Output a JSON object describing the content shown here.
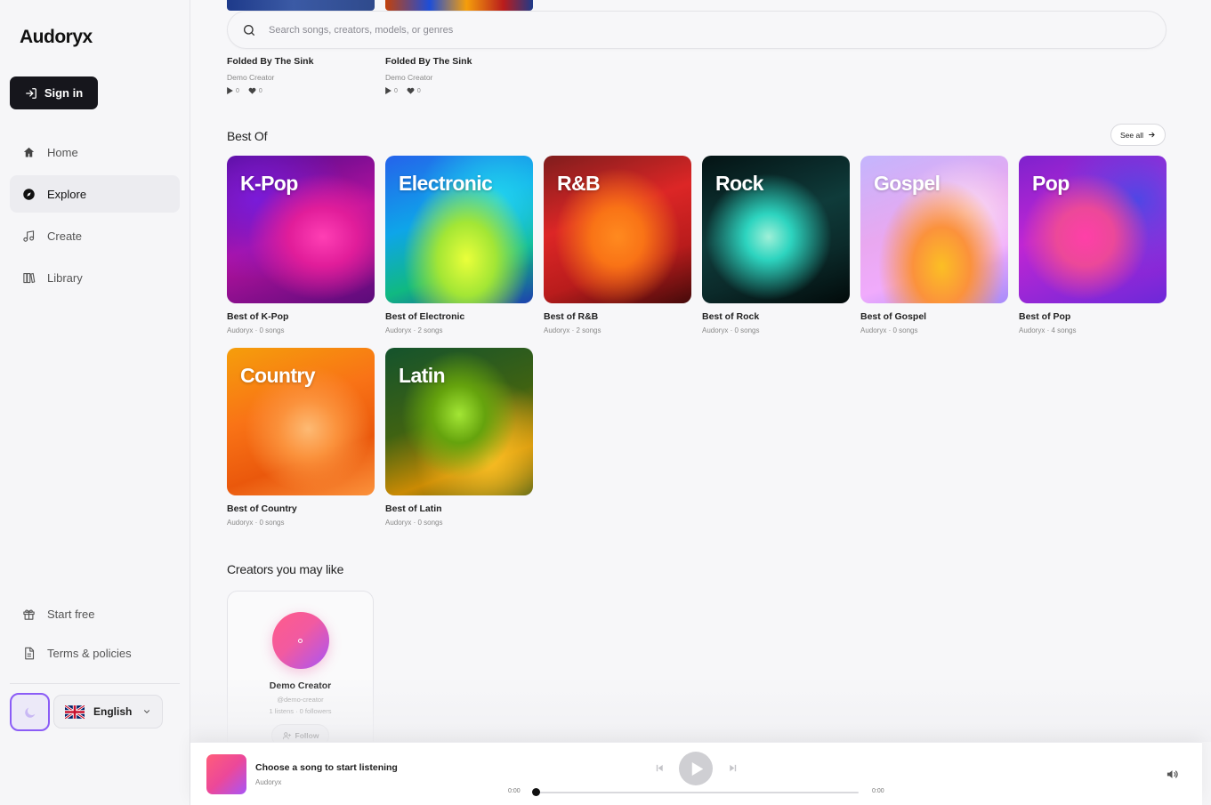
{
  "app": {
    "name": "Audoryx"
  },
  "sidebar": {
    "signin_label": "Sign in",
    "nav": [
      {
        "label": "Home",
        "icon": "home-icon"
      },
      {
        "label": "Explore",
        "icon": "compass-icon",
        "active": true
      },
      {
        "label": "Create",
        "icon": "music-note-icon"
      },
      {
        "label": "Library",
        "icon": "library-icon"
      }
    ],
    "bottom": [
      {
        "label": "Start free",
        "icon": "gift-icon"
      },
      {
        "label": "Terms & policies",
        "icon": "document-icon"
      }
    ],
    "language": "English"
  },
  "search": {
    "placeholder": "Search songs, creators, models, or genres"
  },
  "top_songs": [
    {
      "title": "Folded By The Sink",
      "creator": "Demo Creator",
      "plays": "0",
      "likes": "0"
    },
    {
      "title": "Folded By The Sink",
      "creator": "Demo Creator",
      "plays": "0",
      "likes": "0"
    }
  ],
  "best_of": {
    "title": "Best Of",
    "see_all": "See all",
    "items": [
      {
        "art_label": "K-Pop",
        "title": "Best of K-Pop",
        "sub": "Audoryx · 0 songs"
      },
      {
        "art_label": "Electronic",
        "title": "Best of Electronic",
        "sub": "Audoryx · 2 songs"
      },
      {
        "art_label": "R&B",
        "title": "Best of R&B",
        "sub": "Audoryx · 2 songs"
      },
      {
        "art_label": "Rock",
        "title": "Best of Rock",
        "sub": "Audoryx · 0 songs"
      },
      {
        "art_label": "Gospel",
        "title": "Best of Gospel",
        "sub": "Audoryx · 0 songs"
      },
      {
        "art_label": "Pop",
        "title": "Best of Pop",
        "sub": "Audoryx · 4 songs"
      },
      {
        "art_label": "Country",
        "title": "Best of Country",
        "sub": "Audoryx · 0 songs"
      },
      {
        "art_label": "Latin",
        "title": "Best of Latin",
        "sub": "Audoryx · 0 songs"
      }
    ]
  },
  "creators": {
    "title": "Creators you may like",
    "items": [
      {
        "name": "Demo Creator",
        "handle": "@demo-creator",
        "stats": "1 listens · 0 followers",
        "follow_label": "Follow"
      }
    ]
  },
  "player": {
    "title": "Choose a song to start listening",
    "artist": "Audoryx",
    "elapsed": "0:00",
    "duration": "0:00",
    "progress": 0
  },
  "colors": {
    "accent": "#8b5cf6",
    "signin_bg": "#16161c"
  }
}
